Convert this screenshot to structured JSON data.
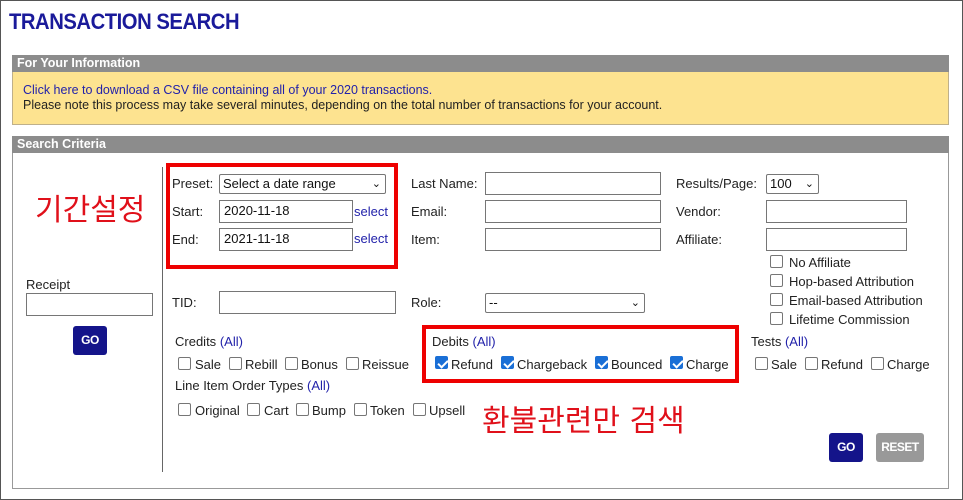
{
  "title": "TRANSACTION SEARCH",
  "info": {
    "header": "For Your Information",
    "csv_link": "Click here to download a CSV file containing all of your 2020 transactions.",
    "note": "Please note this process may take several minutes, depending on the total number of transactions for your account."
  },
  "search": {
    "header": "Search Criteria",
    "receipt_label": "Receipt",
    "receipt_value": "",
    "go_label": "GO",
    "reset_label": "RESET",
    "preset_label": "Preset:",
    "preset_value": "Select a date range",
    "start_label": "Start:",
    "start_value": "2020-11-18",
    "end_label": "End:",
    "end_value": "2021-11-18",
    "select_link": "select",
    "tid_label": "TID:",
    "last_name_label": "Last Name:",
    "email_label": "Email:",
    "item_label": "Item:",
    "role_label": "Role:",
    "role_value": "--",
    "results_label": "Results/Page:",
    "results_value": "100",
    "vendor_label": "Vendor:",
    "affiliate_label": "Affiliate:",
    "affiliate_options": [
      {
        "label": "No Affiliate",
        "checked": false
      },
      {
        "label": "Hop-based Attribution",
        "checked": false
      },
      {
        "label": "Email-based Attribution",
        "checked": false
      },
      {
        "label": "Lifetime Commission",
        "checked": false
      }
    ],
    "credits_label": "Credits",
    "credits_all": "(All)",
    "credits": [
      {
        "label": "Sale",
        "checked": false
      },
      {
        "label": "Rebill",
        "checked": false
      },
      {
        "label": "Bonus",
        "checked": false
      },
      {
        "label": "Reissue",
        "checked": false
      }
    ],
    "line_item_label": "Line Item Order Types",
    "line_item_all": "(All)",
    "line_items": [
      {
        "label": "Original",
        "checked": false
      },
      {
        "label": "Cart",
        "checked": false
      },
      {
        "label": "Bump",
        "checked": false
      },
      {
        "label": "Token",
        "checked": false
      },
      {
        "label": "Upsell",
        "checked": false
      }
    ],
    "debits_label": "Debits",
    "debits_all": "(All)",
    "debits": [
      {
        "label": "Refund",
        "checked": true
      },
      {
        "label": "Chargeback",
        "checked": true
      },
      {
        "label": "Bounced",
        "checked": true
      },
      {
        "label": "Charge",
        "checked": true
      }
    ],
    "tests_label": "Tests",
    "tests_all": "(All)",
    "tests": [
      {
        "label": "Sale",
        "checked": false
      },
      {
        "label": "Refund",
        "checked": false
      },
      {
        "label": "Charge",
        "checked": false
      }
    ]
  },
  "annotations": {
    "period": "기간설정",
    "refund_only": "환불관련만 검색",
    "color": "#e00000"
  }
}
